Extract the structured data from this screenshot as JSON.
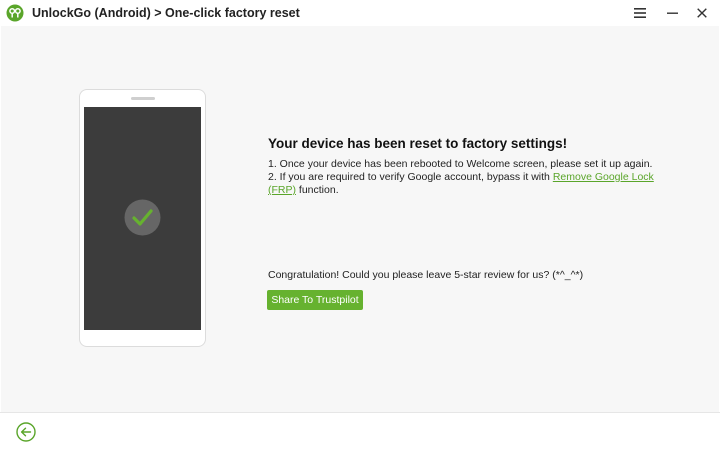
{
  "window": {
    "title": "UnlockGo (Android) > One-click factory reset",
    "icons": {
      "logo": "unlockgo-logo-icon",
      "menu": "hamburger-menu-icon",
      "minimize": "minimize-icon",
      "close": "close-icon"
    }
  },
  "main": {
    "heading": "Your device has been reset to factory settings!",
    "step1": "1. Once your device has been rebooted to Welcome screen, please set it up again.",
    "step2_prefix": "2. If you are required to verify Google account, bypass it with ",
    "step2_link_part1": "Remove Google Lock",
    "step2_link_part2": "(FRP)",
    "step2_suffix": " function.",
    "congrats": "Congratulation! Could you please leave 5-star review for us? (*^_^*)",
    "share_button": "Share To Trustpilot"
  },
  "colors": {
    "accent": "#66b22f",
    "link": "#5aa52a",
    "phone_screen": "#3c3c3c"
  },
  "footer": {
    "back_icon": "back-arrow-icon"
  }
}
